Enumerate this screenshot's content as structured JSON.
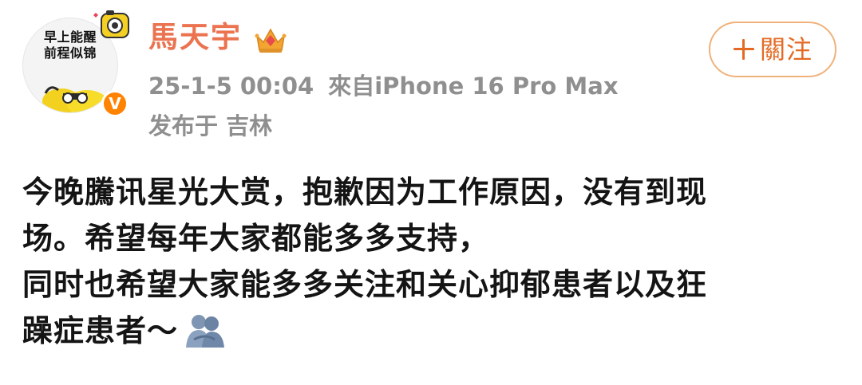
{
  "avatar": {
    "text_lines": [
      "早上能醒",
      "前程似锦"
    ],
    "badge": "V",
    "badge_color": "#ff8200"
  },
  "user": {
    "name": "馬天宇",
    "name_color": "#eb7350",
    "badge_icon": "crown-icon"
  },
  "post_meta": {
    "date": "25-1-5 00:04",
    "source": "來自iPhone 16 Pro Max",
    "location": "发布于 吉林"
  },
  "follow_button": {
    "label": "關注",
    "icon": "plus-icon",
    "accent": "#e46a24"
  },
  "post": {
    "lines": [
      "今晚騰讯星光大赏，抱歉因为工作原因，没有到现",
      "场。希望每年大家都能多多支持，",
      "同时也希望大家能多多关注和关心抑郁患者以及狂",
      "躁症患者～"
    ],
    "trailing_emoji": "hug-emoji"
  }
}
